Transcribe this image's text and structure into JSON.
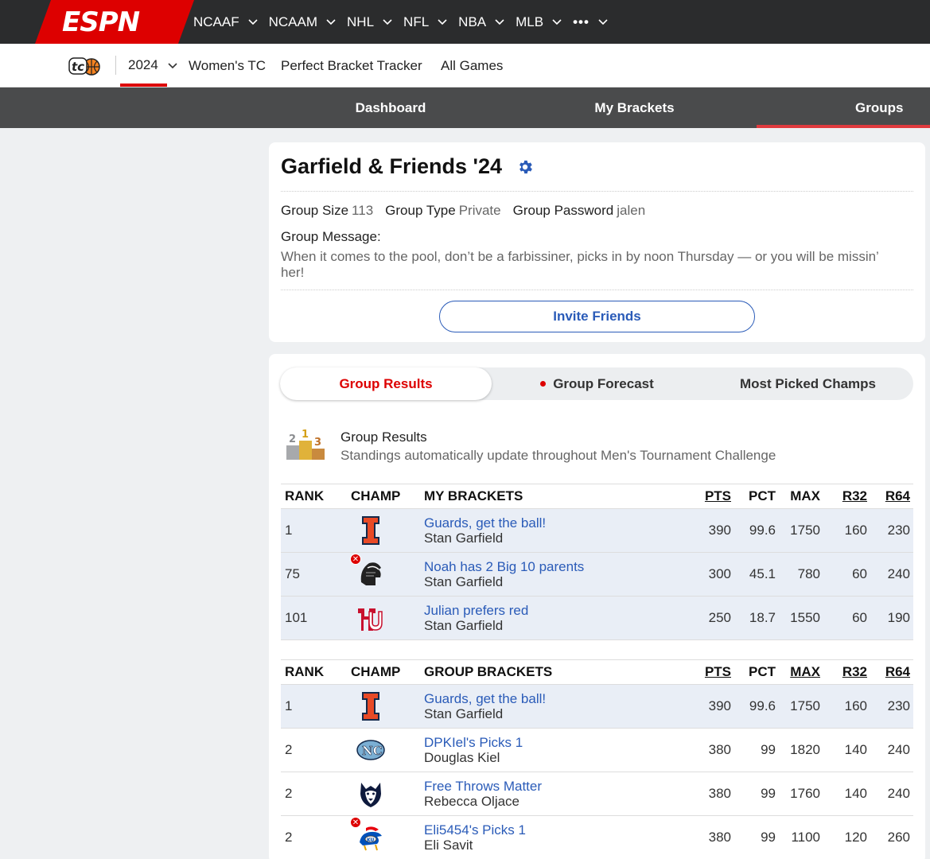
{
  "topnav": {
    "brand": "ESPN",
    "items": [
      {
        "label": "NCAAF"
      },
      {
        "label": "NCAAM"
      },
      {
        "label": "NHL"
      },
      {
        "label": "NFL"
      },
      {
        "label": "NBA"
      },
      {
        "label": "MLB"
      },
      {
        "label": "•••"
      }
    ]
  },
  "subnav": {
    "logo": "tc-basketball-logo",
    "year": "2024",
    "links": [
      "Women's TC",
      "Perfect Bracket Tracker",
      "All Games"
    ]
  },
  "tabs": {
    "items": [
      "Dashboard",
      "My Brackets",
      "Groups"
    ],
    "active": "Groups"
  },
  "group": {
    "title": "Garfield & Friends '24",
    "size_label": "Group Size",
    "size_value": "113",
    "type_label": "Group Type",
    "type_value": "Private",
    "password_label": "Group Password",
    "password_value": "jalen",
    "message_label": "Group Message:",
    "message_text": "When it comes to the pool, don’t be a farbissiner, picks in by noon Thursday — or you will be missin’ her!",
    "invite_label": "Invite Friends"
  },
  "results_tabs": {
    "items": [
      "Group Results",
      "Group Forecast",
      "Most Picked Champs"
    ],
    "active": "Group Results"
  },
  "results_header": {
    "title": "Group Results",
    "subtitle": "Standings automatically update throughout Men's Tournament Challenge"
  },
  "my_table": {
    "columns": {
      "rank": "RANK",
      "champ": "CHAMP",
      "name": "MY BRACKETS",
      "pts": "PTS",
      "pct": "PCT",
      "max": "MAX",
      "r32": "R32",
      "r64": "R64"
    },
    "rows": [
      {
        "rank": "1",
        "champ": "illinois-logo",
        "eliminated": false,
        "name": "Guards, get the ball!",
        "owner": "Stan Garfield",
        "pts": "390",
        "pct": "99.6",
        "max": "1750",
        "r32": "160",
        "r64": "230"
      },
      {
        "rank": "75",
        "champ": "michigan-state-logo",
        "eliminated": true,
        "name": "Noah has 2 Big 10 parents",
        "owner": "Stan Garfield",
        "pts": "300",
        "pct": "45.1",
        "max": "780",
        "r32": "60",
        "r64": "240"
      },
      {
        "rank": "101",
        "champ": "houston-logo",
        "eliminated": false,
        "name": "Julian prefers red",
        "owner": "Stan Garfield",
        "pts": "250",
        "pct": "18.7",
        "max": "1550",
        "r32": "60",
        "r64": "190"
      }
    ]
  },
  "group_table": {
    "columns": {
      "rank": "RANK",
      "champ": "CHAMP",
      "name": "GROUP BRACKETS",
      "pts": "PTS",
      "pct": "PCT",
      "max": "MAX",
      "r32": "R32",
      "r64": "R64"
    },
    "rows": [
      {
        "rank": "1",
        "champ": "illinois-logo",
        "eliminated": false,
        "mine": true,
        "name": "Guards, get the ball!",
        "owner": "Stan Garfield",
        "pts": "390",
        "pct": "99.6",
        "max": "1750",
        "r32": "160",
        "r64": "230"
      },
      {
        "rank": "2",
        "champ": "north-carolina-logo",
        "eliminated": false,
        "mine": false,
        "name": "DPKIel's Picks 1",
        "owner": "Douglas Kiel",
        "pts": "380",
        "pct": "99",
        "max": "1820",
        "r32": "140",
        "r64": "240"
      },
      {
        "rank": "2",
        "champ": "uconn-logo",
        "eliminated": false,
        "mine": false,
        "name": "Free Throws Matter",
        "owner": "Rebecca Oljace",
        "pts": "380",
        "pct": "99",
        "max": "1760",
        "r32": "140",
        "r64": "240"
      },
      {
        "rank": "2",
        "champ": "kansas-logo",
        "eliminated": true,
        "mine": false,
        "name": "Eli5454's Picks 1",
        "owner": "Eli Savit",
        "pts": "380",
        "pct": "99",
        "max": "1100",
        "r32": "120",
        "r64": "260"
      }
    ]
  },
  "colors": {
    "accent": "#d00000",
    "link": "#2a5bb8",
    "highlight_row": "#e9eef6"
  }
}
